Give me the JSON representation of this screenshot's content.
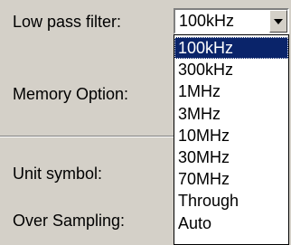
{
  "labels": {
    "low_pass_filter": "Low pass filter:",
    "memory_option": "Memory Option:",
    "unit_symbol": "Unit symbol:",
    "over_sampling": "Over Sampling:"
  },
  "combo": {
    "value": "100kHz",
    "options": [
      "100kHz",
      "300kHz",
      "1MHz",
      "3MHz",
      "10MHz",
      "30MHz",
      "70MHz",
      "Through",
      "Auto"
    ],
    "selected_index": 0
  },
  "colors": {
    "window_bg": "#d4d0c8",
    "selection_bg": "#0a246a",
    "selection_text": "#ffffff"
  }
}
